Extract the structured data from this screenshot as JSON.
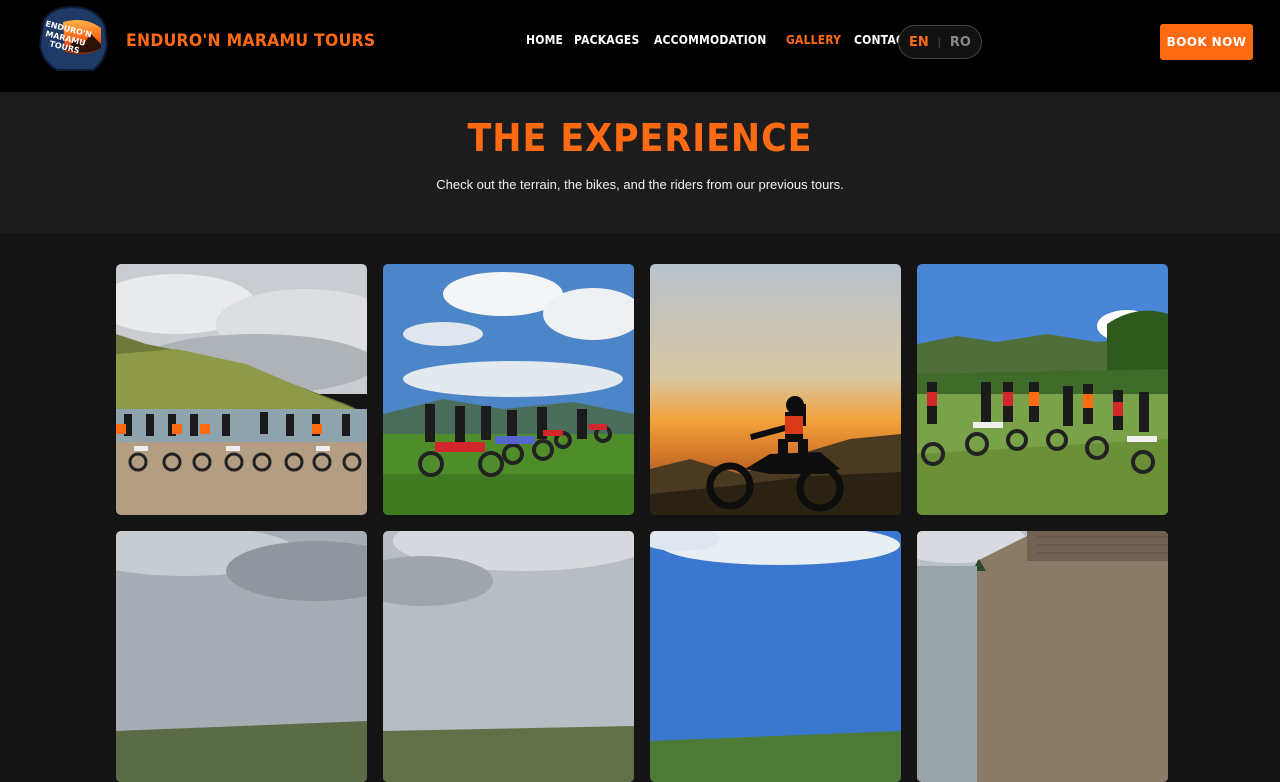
{
  "brand": {
    "name": "ENDURO'N MARAMU TOURS",
    "badge_text": [
      "ENDURO'N",
      "MARAMU",
      "TOURS"
    ]
  },
  "nav": {
    "items": [
      {
        "label": "HOME"
      },
      {
        "label": "PACKAGES"
      },
      {
        "label": "ACCOMMODATION"
      },
      {
        "label": "GALLERY"
      },
      {
        "label": "CONTACT"
      }
    ],
    "active": "GALLERY"
  },
  "language": {
    "current": "EN",
    "other": "RO",
    "separator": "|"
  },
  "cta": {
    "label": "BOOK NOW"
  },
  "hero": {
    "title": "THE EXPERIENCE",
    "subtitle": "Check out the terrain, the bikes, and the riders from our previous tours."
  },
  "colors": {
    "accent": "#ff6a13",
    "navbar_bg": "#000000",
    "hero_bg": "#1c1c1c",
    "page_bg": "#141414"
  },
  "gallery": {
    "photos": [
      {
        "scene": "riders-lineup-lake"
      },
      {
        "scene": "riders-mountain-meadow"
      },
      {
        "scene": "rider-sunset-silhouette"
      },
      {
        "scene": "group-forest-hill"
      },
      {
        "scene": "cloudy-sky-1"
      },
      {
        "scene": "cloudy-sky-2"
      },
      {
        "scene": "blue-sky-clouds"
      },
      {
        "scene": "wooden-cabin"
      }
    ]
  }
}
